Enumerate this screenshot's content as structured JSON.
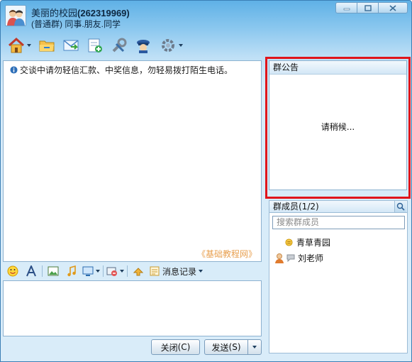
{
  "window": {
    "group_name": "美丽的校园",
    "group_id": "(262319969)",
    "group_type": "(普通群) 同事.朋友.同学",
    "controls": [
      "minimize-icon",
      "maximize-icon",
      "close-icon"
    ]
  },
  "toolbar": {
    "icons": [
      "group-home-icon",
      "group-share-folder-icon",
      "send-message-icon",
      "create-discussion-icon",
      "group-tools-icon",
      "group-admin-icon",
      "group-settings-icon"
    ]
  },
  "chat": {
    "notice": "交谈中请勿轻信汇款、中奖信息，勿轻易拨打陌生电话。",
    "watermark": "《基础教程网》"
  },
  "input_toolbar": {
    "icons": [
      "emoticon-icon",
      "font-icon",
      "image-icon",
      "music-icon",
      "screen-capture-icon",
      "video-icon",
      "shake-icon",
      "message-record-icon"
    ],
    "history_label": "消息记录"
  },
  "buttons": {
    "close_label": "关闭",
    "close_hotkey": "(C)",
    "send_label": "发送",
    "send_hotkey": "(S)"
  },
  "announcement": {
    "title": "群公告",
    "loading_text": "请稍候..."
  },
  "members": {
    "header": "群成员(1/2)",
    "search_placeholder": "搜索群成员",
    "list": [
      {
        "name": "青草青园",
        "icon": "online-status-icon"
      },
      {
        "name": "刘老师",
        "icon": "owner-avatar-icon"
      }
    ]
  },
  "colors": {
    "highlight_border": "#e0151b",
    "watermark": "#e8a050",
    "title_gradient_top": "#5fb1e6"
  }
}
